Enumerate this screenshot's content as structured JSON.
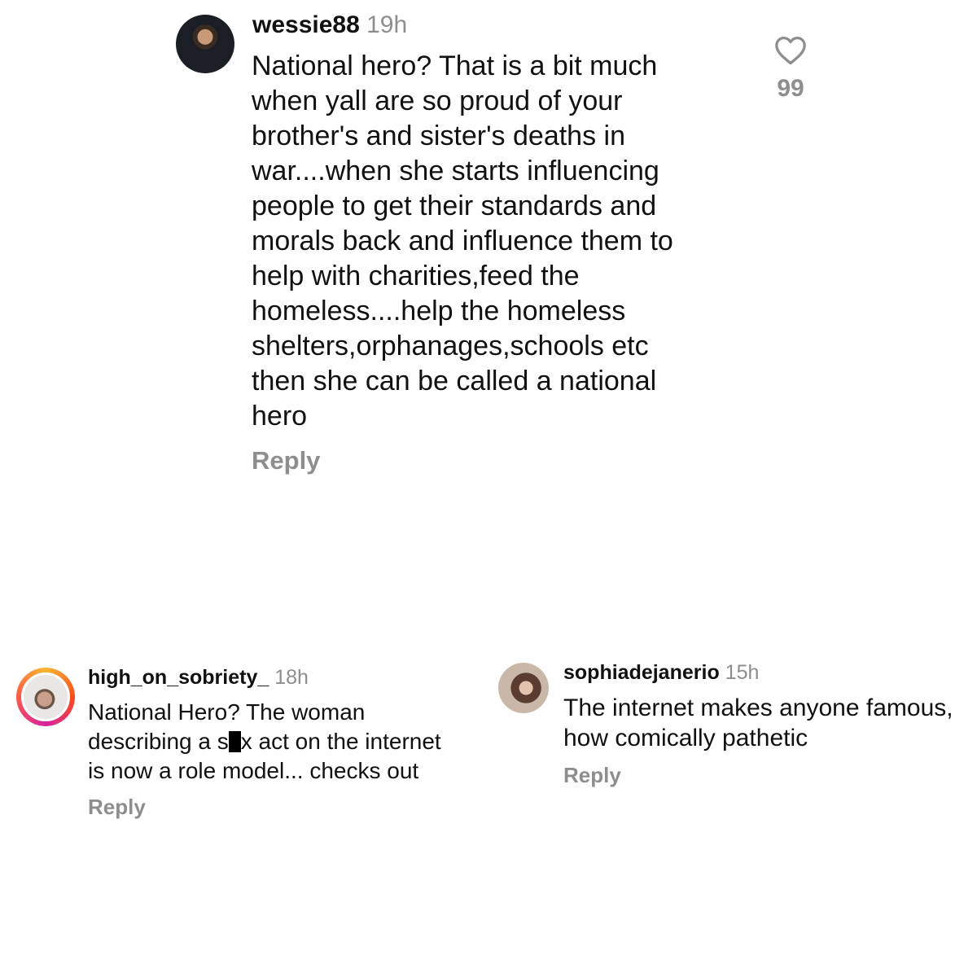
{
  "comments": [
    {
      "username": "wessie88",
      "time": "19h",
      "text": "National hero? That is a bit much\nwhen yall are so proud of your\nbrother's and sister's deaths in\nwar....when she starts influencing\npeople to get their standards and\nmorals back and influence them to\nhelp with charities,feed the\nhomeless....help the homeless\nshelters,orphanages,schools etc\nthen she can be called a national\nhero",
      "reply_label": "Reply",
      "likes": "99",
      "like_icon": "heart-outline-icon"
    },
    {
      "username": "high_on_sobriety_",
      "time": "18h",
      "text_part1": "National Hero? The woman\ndescribing a s",
      "text_part2": "x act on the internet\nis now a role model... checks out",
      "reply_label": "Reply"
    },
    {
      "username": "sophiadejanerio",
      "time": "15h",
      "text": "The internet makes anyone famous,\nhow comically pathetic",
      "reply_label": "Reply"
    }
  ],
  "colors": {
    "text": "#111111",
    "muted": "#8e8e8e",
    "story_ring": [
      "#f7b733",
      "#fc4a1a",
      "#d6249f"
    ]
  }
}
